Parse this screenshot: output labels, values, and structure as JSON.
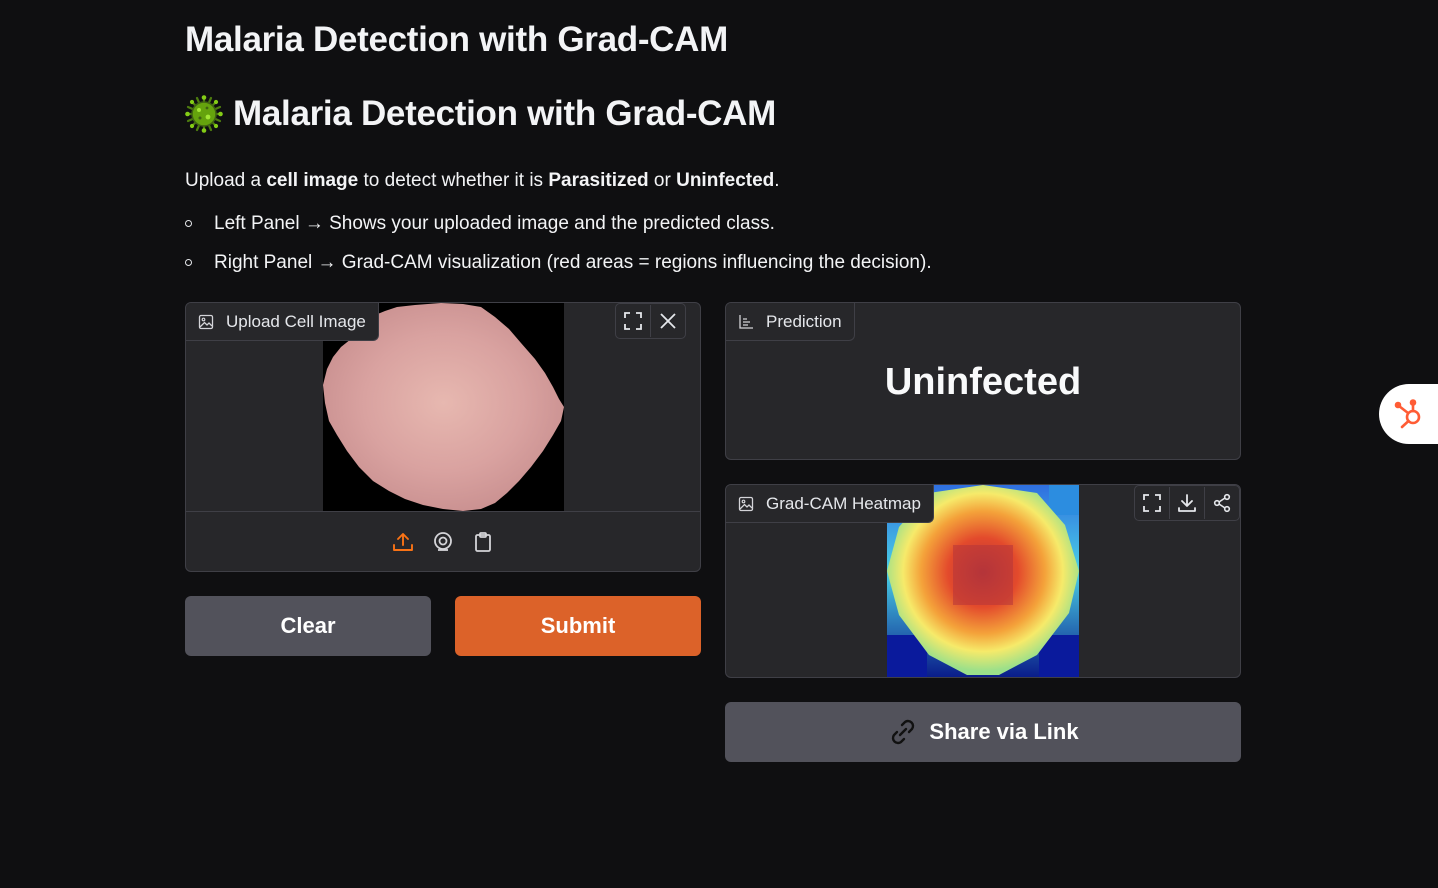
{
  "page": {
    "title": "Malaria Detection with Grad-CAM",
    "hero_title": "Malaria Detection with Grad-CAM",
    "intro": {
      "p1": "Upload a ",
      "b1": "cell image",
      "p2": " to detect whether it is ",
      "b2": "Parasitized",
      "p3": " or ",
      "b3": "Uninfected",
      "p4": "."
    },
    "bullets": [
      "Left Panel → Shows your uploaded image and the predicted class.",
      "Right Panel → Grad-CAM visualization (red areas = regions influencing the decision)."
    ]
  },
  "upload_panel": {
    "label": "Upload Cell Image"
  },
  "buttons": {
    "clear": "Clear",
    "submit": "Submit",
    "share": "Share via Link"
  },
  "prediction_panel": {
    "label": "Prediction",
    "value": "Uninfected"
  },
  "heatmap_panel": {
    "label": "Grad-CAM Heatmap"
  },
  "icons": {
    "virus": "virus-emoji-icon",
    "image": "image-icon",
    "chart": "bar-chart-icon",
    "fullscreen": "fullscreen-icon",
    "close": "close-icon",
    "upload": "upload-icon",
    "webcam": "webcam-icon",
    "clipboard": "clipboard-icon",
    "download": "download-icon",
    "share": "share-icon",
    "link": "link-icon",
    "hubspot": "hubspot-icon"
  },
  "colors": {
    "background": "#0f0f11",
    "panel": "#27272a",
    "border": "#3f3f46",
    "accent": "#dc6229",
    "secondary_button": "#52525b"
  }
}
